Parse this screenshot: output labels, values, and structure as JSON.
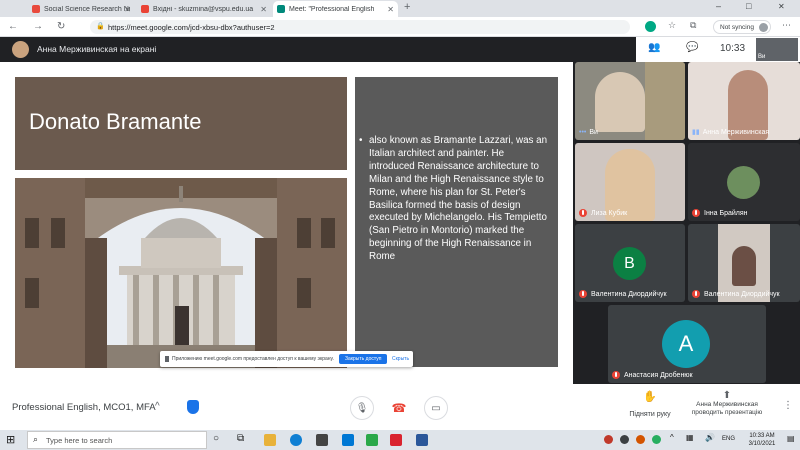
{
  "browser": {
    "tabs": [
      {
        "title": "Social Science Research Network",
        "favicon_color": "#e84a3d"
      },
      {
        "title": "Вхідні - skuzmina@vspu.edu.ua",
        "favicon_color": "#ea4335"
      },
      {
        "title": "Meet: \"Professional English",
        "favicon_color": "#00897b"
      }
    ],
    "new_tab": "+",
    "address": "https://meet.google.com/jcd-xbsu-dbx?authuser=2",
    "not_syncing": "Not syncing",
    "window_controls": {
      "minimize": "–",
      "maximize": "□",
      "close": "✕"
    }
  },
  "meet": {
    "presenter_banner": "Анна Мерживинская на екрані",
    "clock": "10:33",
    "corner_label": "Ви"
  },
  "slide": {
    "title": "Donato Bramante",
    "bullet": "also known as Bramante Lazzari, was an Italian architect and painter. He introduced Renaissance architecture to Milan and the High Renaissance style to Rome, where his plan for St. Peter's Basilica formed the basis of design executed by Michelangelo. His Tempietto (San Pietro in Montorio) marked the beginning of the High Renaissance in Rome",
    "colors": {
      "title_bg": "#6b5a4e",
      "text_bg": "#5a5a5a"
    }
  },
  "share_notice": {
    "text": "Приложению meet.google.com предоставлен доступ к вашему экрану.",
    "stop_button": "Закрыть доступ",
    "hide_button": "Скрыть"
  },
  "participants": [
    {
      "name": "Ви",
      "avatar": ""
    },
    {
      "name": "Анна Мерживинская",
      "avatar": ""
    },
    {
      "name": "Лиза Кубик",
      "avatar": ""
    },
    {
      "name": "Інна Брайлян",
      "avatar": ""
    },
    {
      "name": "Валентина Диордийчук",
      "avatar": "В",
      "avatar_color": "#0b8043"
    },
    {
      "name": "Валентина Диордийчук",
      "avatar": ""
    },
    {
      "name": "Анастасия Дробенюк",
      "avatar": "А",
      "avatar_color": "#129eaf"
    }
  ],
  "controls": {
    "meeting_name": "Professional English, MCO1, MFA",
    "caret": "^",
    "raise_hand": "Підняти руку",
    "presenting": "Анна Мерживинская проводить презентацію"
  },
  "taskbar": {
    "search_placeholder": "Type here to search",
    "language": "ENG",
    "time": "10:33 AM",
    "date": "3/10/2021"
  }
}
